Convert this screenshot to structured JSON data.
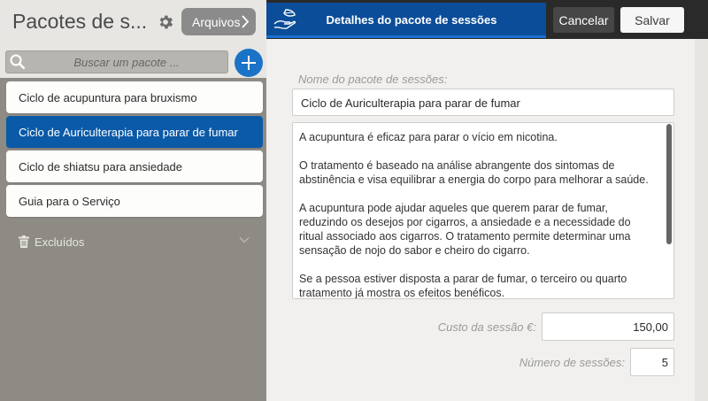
{
  "sidebar": {
    "title": "Pacotes de s...",
    "archive_label": "Arquivos",
    "search_placeholder": "Buscar um pacote ...",
    "items": [
      {
        "label": "Ciclo de acupuntura para bruxismo"
      },
      {
        "label": "Ciclo de Auriculterapia para parar de fumar"
      },
      {
        "label": "Ciclo de shiatsu para ansiedade"
      },
      {
        "label": "Guia para o Serviço"
      }
    ],
    "deleted_label": "Excluídos"
  },
  "header": {
    "title": "Detalhes do pacote de sessões",
    "cancel_label": "Cancelar",
    "save_label": "Salvar"
  },
  "form": {
    "name_label": "Nome do pacote de sessões:",
    "name_value": "Ciclo de Auriculterapia para parar de fumar",
    "description": [
      "A acupuntura é eficaz para parar o vício em nicotina.",
      "O tratamento é baseado na análise abrangente dos sintomas de abstinência e visa equilibrar a energia do corpo para melhorar a saúde.",
      "A acupuntura pode ajudar aqueles que querem parar de fumar, reduzindo os desejos por cigarros, a ansiedade e a necessidade do ritual associado aos cigarros. O tratamento permite determinar uma sensação de nojo do sabor e cheiro do cigarro.",
      "Se a pessoa estiver disposta a parar de fumar, o terceiro ou quarto tratamento já mostra os efeitos benéficos."
    ],
    "price_label": "Custo da sessão €:",
    "price_value": "150,00",
    "count_label": "Número de sessões:",
    "count_value": "5"
  },
  "colors": {
    "accent": "#0b5aa8",
    "header_blue": "#0b4d98",
    "add_button": "#1a73c7",
    "sidebar_bg": "#8e8b85"
  },
  "icons": {
    "settings": "gear-icon",
    "archive_chevron": "chevron-right-icon",
    "search": "search-icon",
    "add": "plus-icon",
    "deleted": "trash-icon",
    "deleted_toggle": "chevron-down-icon",
    "logo": "hand-leaf-icon"
  }
}
